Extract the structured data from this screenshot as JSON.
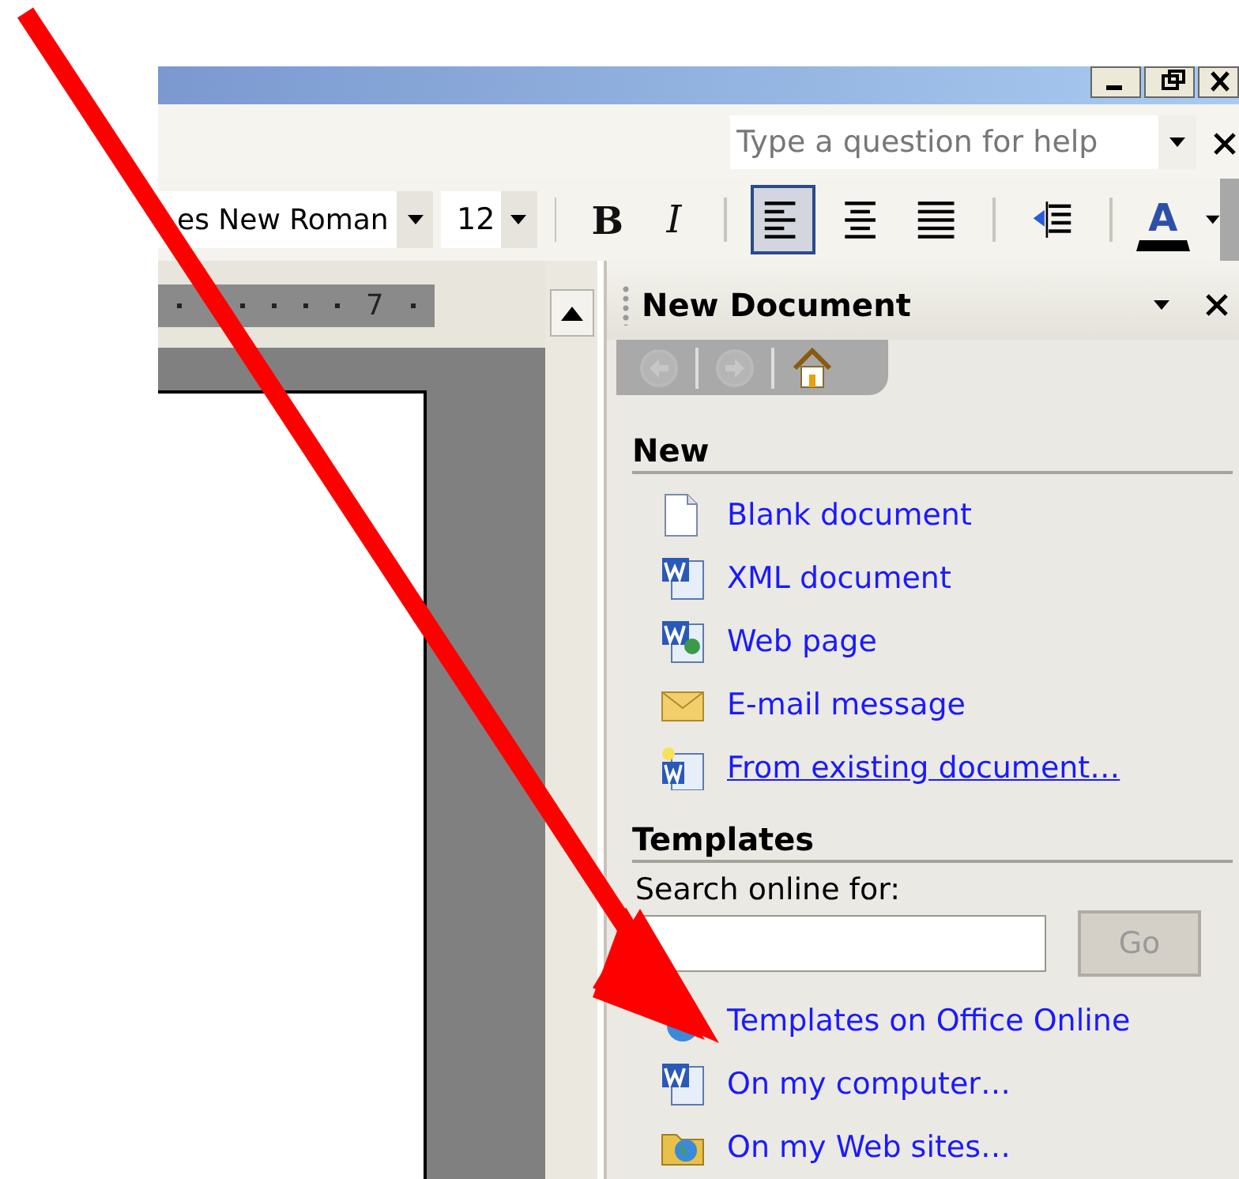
{
  "help": {
    "placeholder": "Type a question for help"
  },
  "formatting": {
    "font": "es New Roman",
    "size": "12",
    "buttons": [
      {
        "kind": "bold",
        "label": "B"
      },
      {
        "kind": "italic",
        "label": "I"
      },
      {
        "kind": "align-left",
        "selected": true
      },
      {
        "kind": "align-center",
        "selected": false
      },
      {
        "kind": "justify",
        "selected": false
      },
      {
        "kind": "outdent"
      },
      {
        "kind": "font-color",
        "label": "A"
      }
    ]
  },
  "ruler": {
    "label": "7"
  },
  "task_pane": {
    "title": "New Document",
    "nav": [
      {
        "kind": "back",
        "disabled": true
      },
      {
        "kind": "forward",
        "disabled": true
      },
      {
        "kind": "home",
        "disabled": false
      }
    ],
    "sections": [
      {
        "heading": "New",
        "links": [
          {
            "kind": "blank",
            "label": "Blank document",
            "underlined": false
          },
          {
            "kind": "word",
            "label": "XML document",
            "underlined": false
          },
          {
            "kind": "web",
            "label": "Web page",
            "underlined": false
          },
          {
            "kind": "mail",
            "label": "E-mail message",
            "underlined": false
          },
          {
            "kind": "existing",
            "label": "From existing document…",
            "underlined": true
          }
        ]
      },
      {
        "heading": "Templates",
        "search": {
          "label": "Search online for:",
          "button": {
            "label": "Go",
            "disabled": true
          }
        },
        "links": [
          {
            "kind": "globe",
            "label": "Templates on Office Online",
            "underlined": false
          },
          {
            "kind": "word",
            "label": "On my computer…",
            "underlined": false
          },
          {
            "kind": "folder",
            "label": "On my Web sites…",
            "underlined": false
          }
        ]
      }
    ]
  }
}
